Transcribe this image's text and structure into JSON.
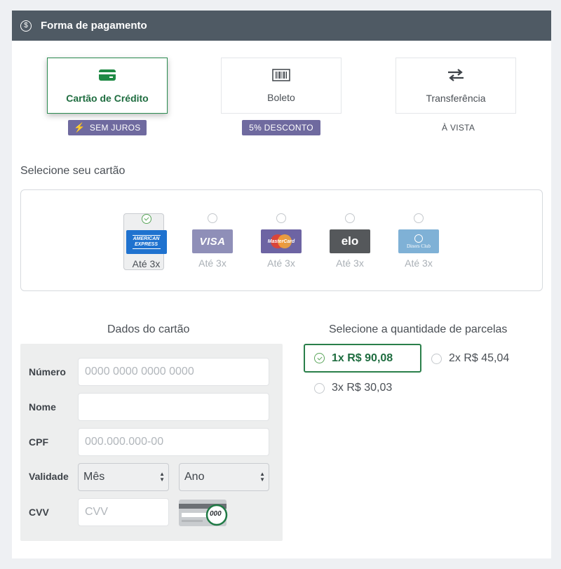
{
  "header": {
    "title": "Forma de pagamento",
    "icon": "dollar-circle-icon"
  },
  "methods": [
    {
      "label": "Cartão de Crédito",
      "badge": "SEM JUROS",
      "active": true,
      "icon": "credit-card-icon"
    },
    {
      "label": "Boleto",
      "badge": "5% DESCONTO",
      "active": false,
      "icon": "barcode-icon"
    },
    {
      "label": "Transferência",
      "note": "À VISTA",
      "active": false,
      "icon": "transfer-arrows-icon"
    }
  ],
  "cards_section": {
    "title": "Selecione seu cartão",
    "cards": [
      {
        "brand": "American Express",
        "brand_text": "AMERICAN EXPRESS",
        "limit": "Até 3x",
        "selected": true
      },
      {
        "brand": "Visa",
        "brand_text": "VISA",
        "limit": "Até 3x",
        "selected": false
      },
      {
        "brand": "MasterCard",
        "brand_text": "MasterCard",
        "limit": "Até 3x",
        "selected": false
      },
      {
        "brand": "Elo",
        "brand_text": "elo",
        "limit": "Até 3x",
        "selected": false
      },
      {
        "brand": "Diners Club International",
        "brand_text": "Diners Club",
        "limit": "Até 3x",
        "selected": false
      }
    ]
  },
  "card_form": {
    "title": "Dados do cartão",
    "numero_label": "Número",
    "numero_placeholder": "0000 0000 0000 0000",
    "nome_label": "Nome",
    "nome_value": "",
    "cpf_label": "CPF",
    "cpf_placeholder": "000.000.000-00",
    "validade_label": "Validade",
    "mes_value": "Mês",
    "ano_value": "Ano",
    "cvv_label": "CVV",
    "cvv_placeholder": "CVV",
    "cvv_hint": "000"
  },
  "installments": {
    "title": "Selecione a quantidade de parcelas",
    "options": [
      {
        "label": "1x R$ 90,08",
        "selected": true
      },
      {
        "label": "2x R$ 45,04",
        "selected": false
      },
      {
        "label": "3x R$ 30,03",
        "selected": false
      }
    ]
  },
  "colors": {
    "accent": "#2a8a4f",
    "header_bg": "#4f5a64",
    "badge": "#6f6a9f"
  }
}
